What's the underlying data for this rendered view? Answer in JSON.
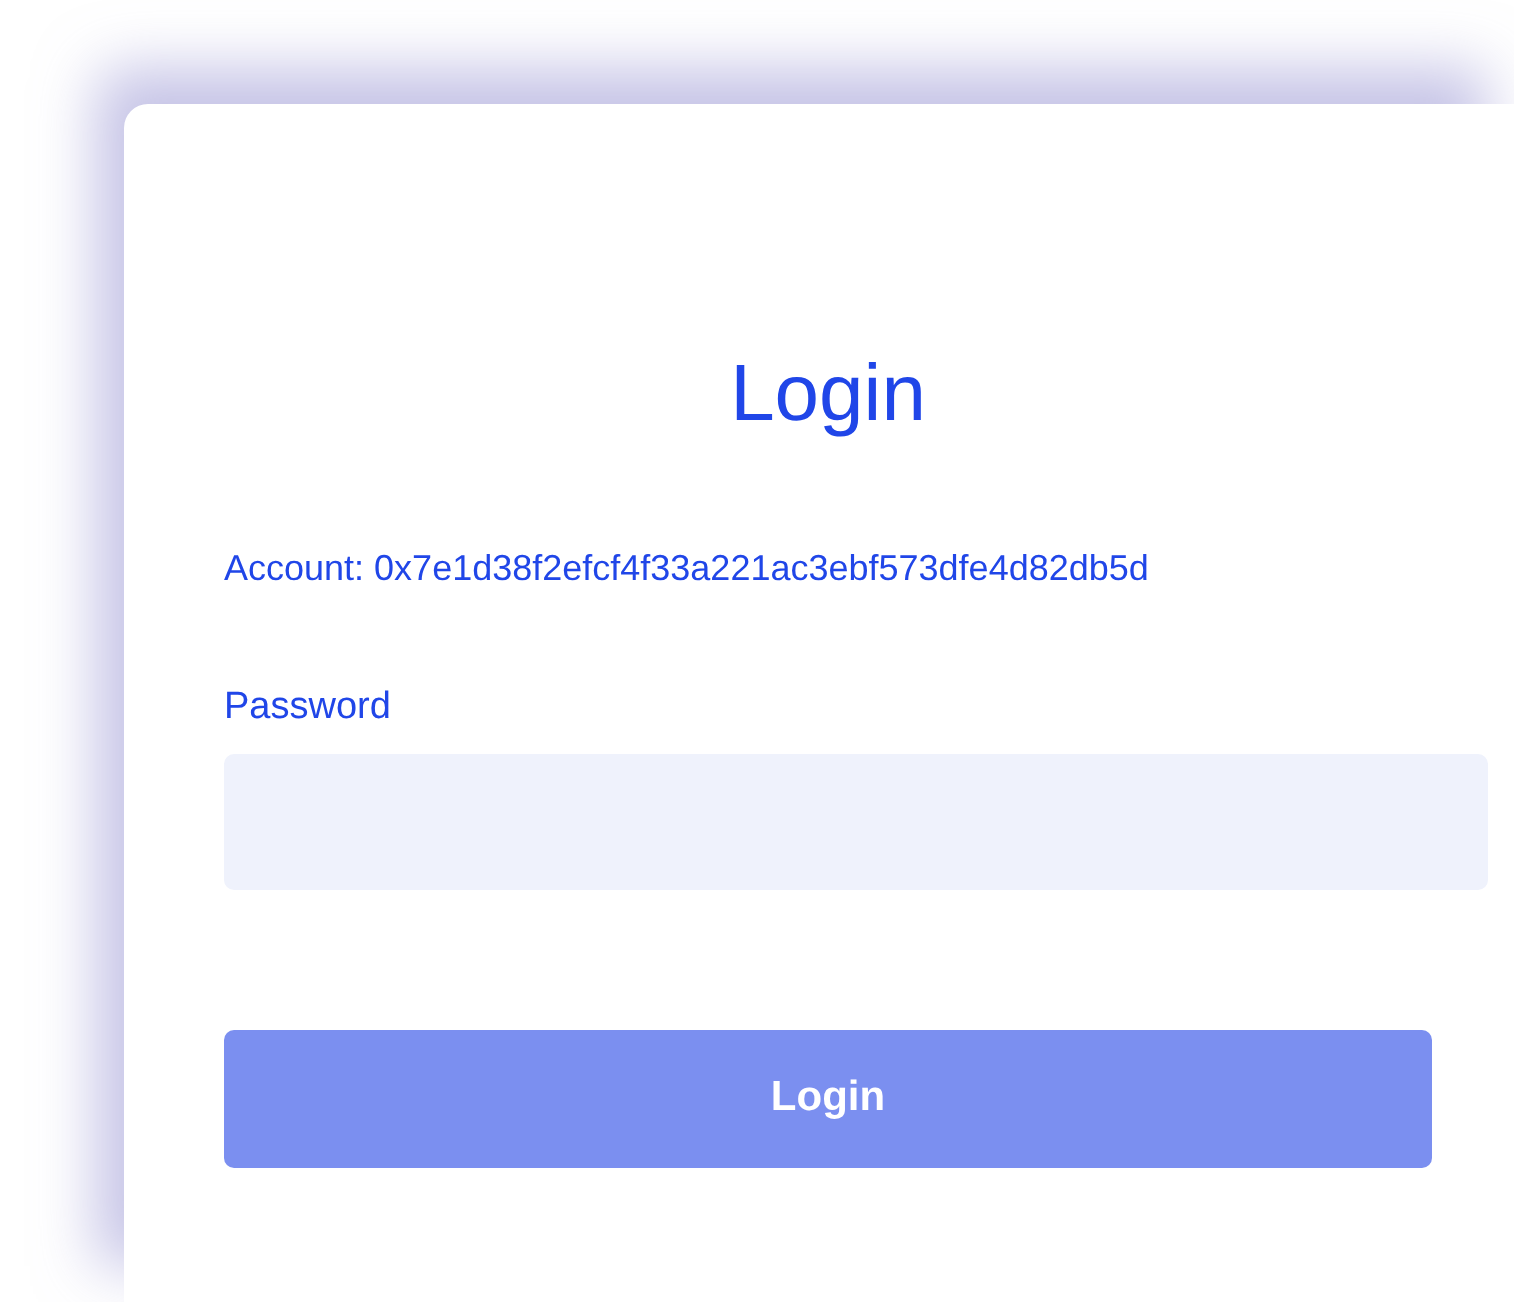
{
  "title": "Login",
  "account": "Account: 0x7e1d38f2efcf4f33a221ac3ebf573dfe4d82db5d",
  "password": {
    "label": "Password"
  },
  "button": "Login"
}
